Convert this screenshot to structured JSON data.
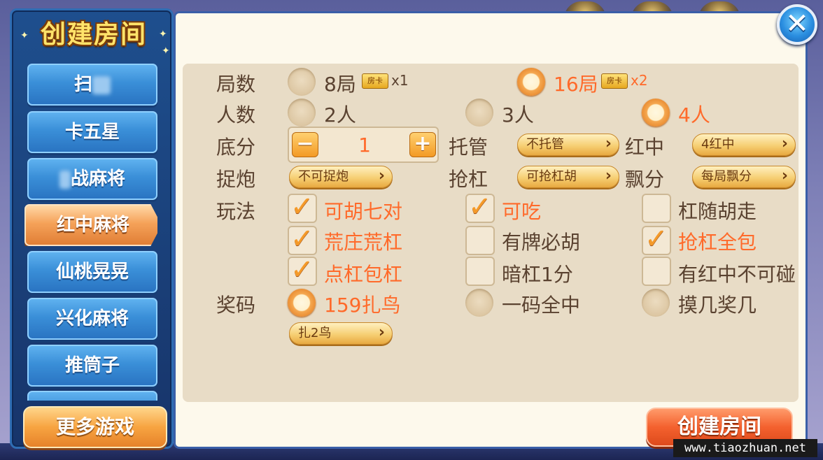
{
  "sidebar": {
    "title": "创建房间",
    "items": [
      {
        "label": "扫"
      },
      {
        "label": "卡五星"
      },
      {
        "label": "战麻将"
      },
      {
        "label": "红中麻将"
      },
      {
        "label": "仙桃晃晃"
      },
      {
        "label": "兴化麻将"
      },
      {
        "label": "推筒子"
      }
    ],
    "more_games_label": "更多游戏"
  },
  "settings": {
    "rounds": {
      "label": "局数",
      "options": [
        {
          "text": "8局",
          "card_label": "房卡",
          "mult": "x1",
          "selected": false
        },
        {
          "text": "16局",
          "card_label": "房卡",
          "mult": "x2",
          "selected": true
        }
      ]
    },
    "players": {
      "label": "人数",
      "options": [
        {
          "text": "2人",
          "selected": false
        },
        {
          "text": "3人",
          "selected": false
        },
        {
          "text": "4人",
          "selected": true
        }
      ]
    },
    "base_score": {
      "label": "底分",
      "minus": "−",
      "plus": "+",
      "value": "1"
    },
    "auto_play": {
      "label": "托管",
      "value": "不托管"
    },
    "red_zhong": {
      "label": "红中",
      "value": "4红中"
    },
    "catch_pao": {
      "label": "捉炮",
      "value": "不可捉炮"
    },
    "rob_kong": {
      "label": "抢杠",
      "value": "可抢杠胡"
    },
    "piao": {
      "label": "飘分",
      "value": "每局飘分"
    },
    "play": {
      "label": "玩法",
      "options": [
        {
          "text": "可胡七对",
          "checked": true
        },
        {
          "text": "可吃",
          "checked": true
        },
        {
          "text": "杠随胡走",
          "checked": false
        },
        {
          "text": "荒庄荒杠",
          "checked": true
        },
        {
          "text": "有牌必胡",
          "checked": false
        },
        {
          "text": "抢杠全包",
          "checked": true
        },
        {
          "text": "点杠包杠",
          "checked": true
        },
        {
          "text": "暗杠1分",
          "checked": false
        },
        {
          "text": "有红中不可碰",
          "checked": false
        }
      ]
    },
    "award": {
      "label": "奖码",
      "options": [
        {
          "text": "159扎鸟",
          "selected": true
        },
        {
          "text": "一码全中",
          "selected": false
        },
        {
          "text": "摸几奖几",
          "selected": false
        }
      ],
      "bird_count": "扎2鸟"
    }
  },
  "create_button_label": "创建房间",
  "close_label": "✕",
  "watermark": "www.tiaozhuan.net",
  "colors": {
    "accent_orange": "#ff6a2a",
    "text_brown": "#5a4230",
    "panel_blue": "#1e4f8e"
  }
}
